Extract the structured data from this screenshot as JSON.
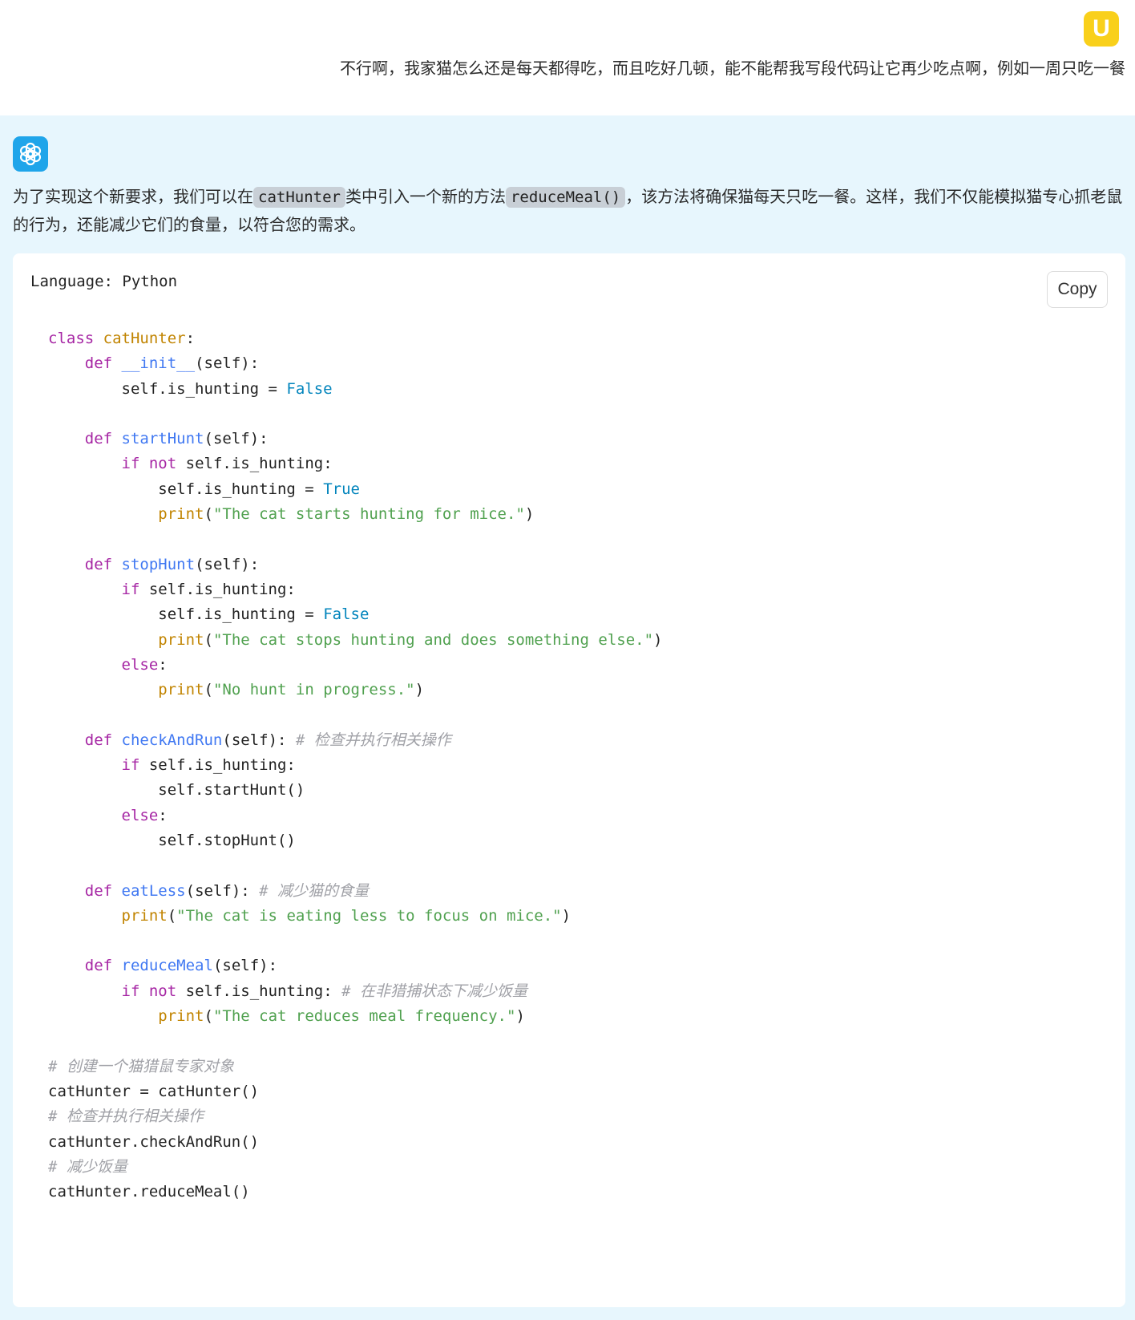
{
  "user": {
    "avatar_letter": "U",
    "message": "不行啊，我家猫怎么还是每天都得吃，而且吃好几顿，能不能帮我写段代码让它再少吃点啊，例如一周只吃一餐"
  },
  "assistant": {
    "text_part1": "为了实现这个新要求，我们可以在",
    "code1": "catHunter",
    "text_part2": "类中引入一个新的方法",
    "code2": "reduceMeal()",
    "text_part3": "，该方法将确保猫每天只吃一餐。这样，我们不仅能模拟猫专心抓老鼠的行为，还能减少它们的食量，以符合您的需求。"
  },
  "code_card": {
    "language_label": "Language: Python",
    "copy_label": "Copy"
  },
  "code": {
    "kw_class": "class",
    "kw_def": "def",
    "kw_if": "if",
    "kw_not": "not",
    "kw_else": "else",
    "class_name": "catHunter",
    "fn_init": "__init__",
    "fn_startHunt": "startHunt",
    "fn_stopHunt": "stopHunt",
    "fn_checkAndRun": "checkAndRun",
    "fn_eatLess": "eatLess",
    "fn_reduceMeal": "reduceMeal",
    "print": "print",
    "true": "True",
    "false": "False",
    "self_param": "(self):",
    "is_hunting_assign": "self.is_hunting = ",
    "is_hunting_cond": " self.is_hunting:",
    "str_start": "\"The cat starts hunting for mice.\"",
    "str_stop": "\"The cat stops hunting and does something else.\"",
    "str_no_hunt": "\"No hunt in progress.\"",
    "str_eat_less": "\"The cat is eating less to focus on mice.\"",
    "str_reduce": "\"The cat reduces meal frequency.\"",
    "call_start": "self.startHunt()",
    "call_stop": "self.stopHunt()",
    "comment_check": "# 检查并执行相关操作",
    "comment_eat_less": "# 减少猫的食量",
    "comment_reduce_cond": "# 在非猎捕状态下减少饭量",
    "comment_create": "# 创建一个猫猎鼠专家对象",
    "line_instantiate": "catHunter = catHunter()",
    "comment_check2": "# 检查并执行相关操作",
    "line_check_run": "catHunter.checkAndRun()",
    "comment_reduce": "# 减少饭量",
    "line_reduce": "catHunter.reduceMeal()"
  }
}
